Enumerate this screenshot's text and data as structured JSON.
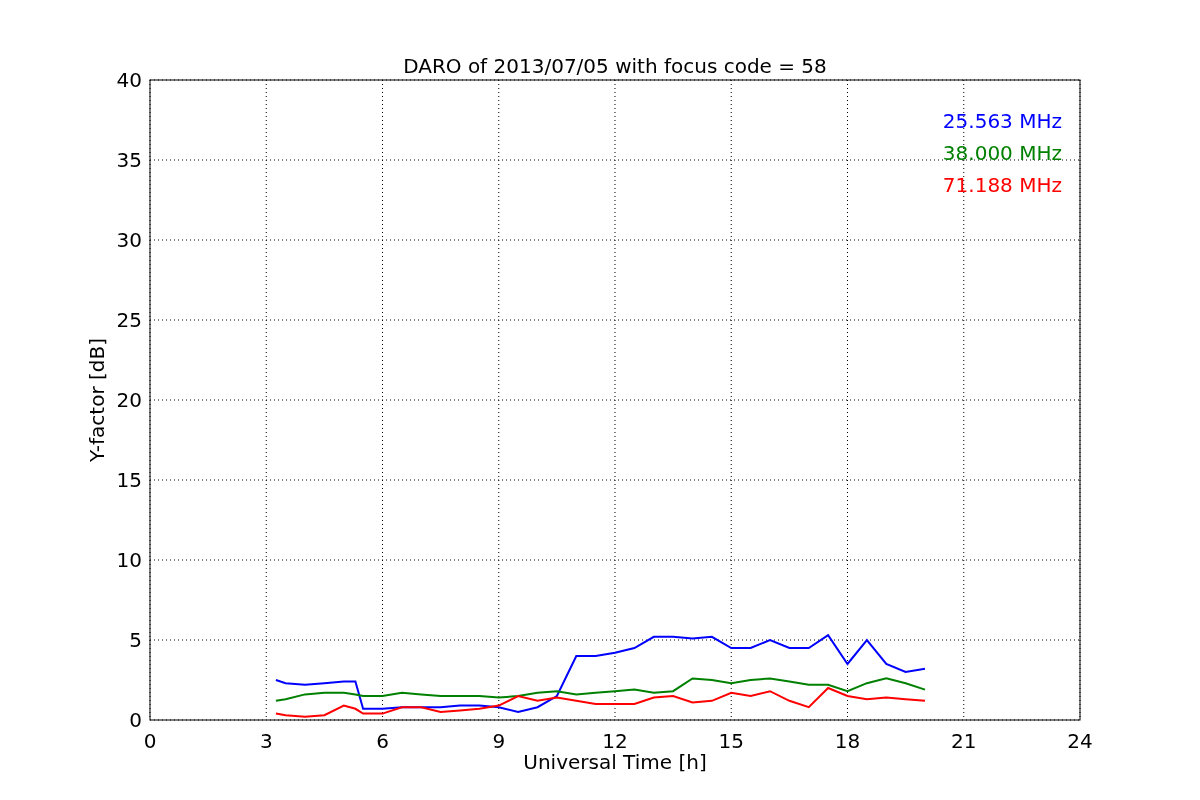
{
  "chart_data": {
    "type": "line",
    "title": "DARO of 2013/07/05 with focus code = 58",
    "xlabel": "Universal Time [h]",
    "ylabel": "Y-factor [dB]",
    "x": [
      3.25,
      3.5,
      4,
      4.5,
      5,
      5.3,
      5.5,
      6,
      6.5,
      7,
      7.5,
      8,
      8.5,
      9,
      9.5,
      10,
      10.5,
      11,
      11.5,
      12,
      12.5,
      13,
      13.5,
      14,
      14.5,
      15,
      15.5,
      16,
      16.5,
      17,
      17.5,
      18,
      18.5,
      19,
      19.5,
      20
    ],
    "grid": true,
    "xlim": [
      0,
      24
    ],
    "ylim": [
      0,
      40
    ],
    "xticks": [
      0,
      3,
      6,
      9,
      12,
      15,
      18,
      21,
      24
    ],
    "yticks": [
      0,
      5,
      10,
      15,
      20,
      25,
      30,
      35,
      40
    ],
    "series": [
      {
        "name": "25.563 MHz",
        "color": "#0000ff",
        "values": [
          2.5,
          2.3,
          2.2,
          2.3,
          2.4,
          2.4,
          0.7,
          0.7,
          0.8,
          0.8,
          0.8,
          0.9,
          0.9,
          0.8,
          0.5,
          0.8,
          1.5,
          4.0,
          4.0,
          4.2,
          4.5,
          5.2,
          5.2,
          5.1,
          5.2,
          4.5,
          4.5,
          5.0,
          4.5,
          4.5,
          5.3,
          3.5,
          5.0,
          3.5,
          3.0,
          3.2
        ]
      },
      {
        "name": "38.000 MHz",
        "color": "#008000",
        "values": [
          1.2,
          1.3,
          1.6,
          1.7,
          1.7,
          1.6,
          1.5,
          1.5,
          1.7,
          1.6,
          1.5,
          1.5,
          1.5,
          1.4,
          1.5,
          1.7,
          1.8,
          1.6,
          1.7,
          1.8,
          1.9,
          1.7,
          1.8,
          2.6,
          2.5,
          2.3,
          2.5,
          2.6,
          2.4,
          2.2,
          2.2,
          1.8,
          2.3,
          2.6,
          2.3,
          1.9
        ]
      },
      {
        "name": "71.188 MHz",
        "color": "#ff0000",
        "values": [
          0.4,
          0.3,
          0.2,
          0.3,
          0.9,
          0.7,
          0.4,
          0.4,
          0.8,
          0.8,
          0.5,
          0.6,
          0.7,
          0.9,
          1.5,
          1.2,
          1.4,
          1.2,
          1.0,
          1.0,
          1.0,
          1.4,
          1.5,
          1.1,
          1.2,
          1.7,
          1.5,
          1.8,
          1.2,
          0.8,
          2.0,
          1.5,
          1.3,
          1.4,
          1.3,
          1.2
        ]
      }
    ]
  }
}
